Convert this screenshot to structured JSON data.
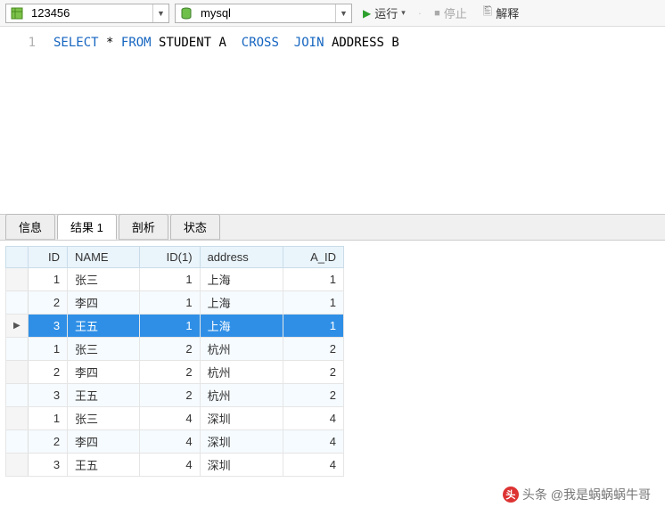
{
  "toolbar": {
    "database_value": "123456",
    "engine_value": "mysql",
    "run_label": "运行",
    "stop_label": "停止",
    "explain_label": "解释"
  },
  "editor": {
    "line_number": "1",
    "sql": {
      "select": "SELECT",
      "star": "*",
      "from": "FROM",
      "tbl1": "STUDENT A",
      "cross": "CROSS",
      "join": "JOIN",
      "tbl2": "ADDRESS B"
    }
  },
  "tabs": {
    "info": "信息",
    "result": "结果 1",
    "profile": "剖析",
    "status": "状态"
  },
  "grid": {
    "columns": [
      "ID",
      "NAME",
      "ID(1)",
      "address",
      "A_ID"
    ],
    "rows": [
      {
        "id": 1,
        "name": "张三",
        "id1": 1,
        "address": "上海",
        "aid": 1,
        "sel": false
      },
      {
        "id": 2,
        "name": "李四",
        "id1": 1,
        "address": "上海",
        "aid": 1,
        "sel": false
      },
      {
        "id": 3,
        "name": "王五",
        "id1": 1,
        "address": "上海",
        "aid": 1,
        "sel": true
      },
      {
        "id": 1,
        "name": "张三",
        "id1": 2,
        "address": "杭州",
        "aid": 2,
        "sel": false
      },
      {
        "id": 2,
        "name": "李四",
        "id1": 2,
        "address": "杭州",
        "aid": 2,
        "sel": false
      },
      {
        "id": 3,
        "name": "王五",
        "id1": 2,
        "address": "杭州",
        "aid": 2,
        "sel": false
      },
      {
        "id": 1,
        "name": "张三",
        "id1": 4,
        "address": "深圳",
        "aid": 4,
        "sel": false
      },
      {
        "id": 2,
        "name": "李四",
        "id1": 4,
        "address": "深圳",
        "aid": 4,
        "sel": false
      },
      {
        "id": 3,
        "name": "王五",
        "id1": 4,
        "address": "深圳",
        "aid": 4,
        "sel": false
      }
    ]
  },
  "watermark": "头条 @我是蜗蜗蜗牛哥"
}
